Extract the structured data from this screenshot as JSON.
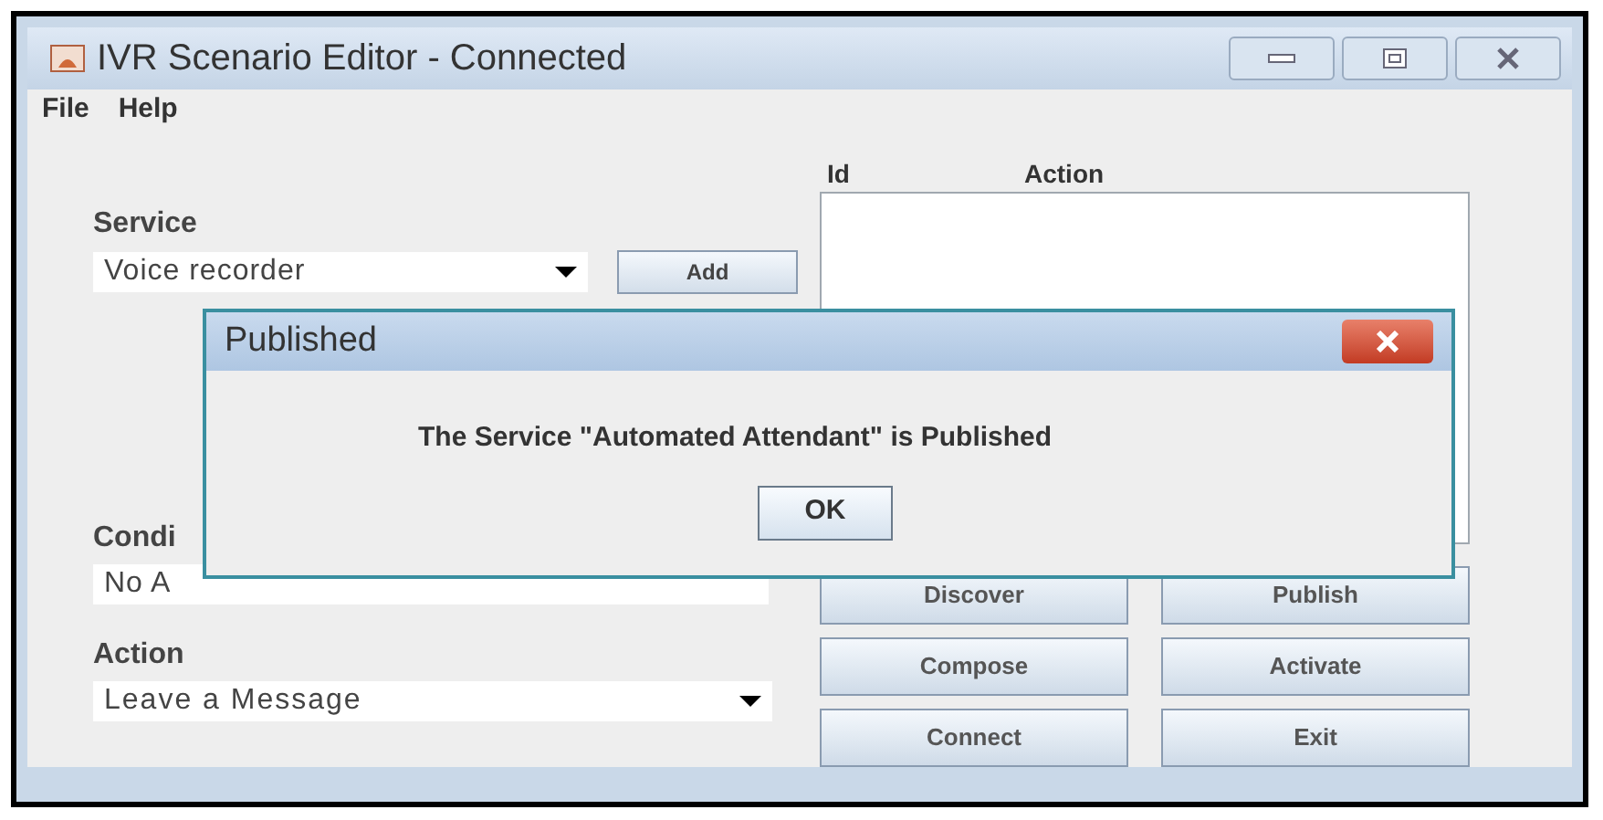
{
  "window": {
    "title": "IVR Scenario Editor - Connected"
  },
  "menu": [
    "File",
    "Help"
  ],
  "service": {
    "label": "Service",
    "value": "Voice recorder",
    "add_button": "Add"
  },
  "condition": {
    "label": "Condi",
    "value": "No A"
  },
  "action": {
    "label": "Action",
    "value": "Leave a Message"
  },
  "table": {
    "columns": [
      "Id",
      "Action"
    ]
  },
  "buttons": [
    "Discover",
    "Publish",
    "Compose",
    "Activate",
    "Connect",
    "Exit"
  ],
  "dialog": {
    "title": "Published",
    "message": "The Service \"Automated Attendant\" is Published",
    "ok_button": "OK"
  }
}
